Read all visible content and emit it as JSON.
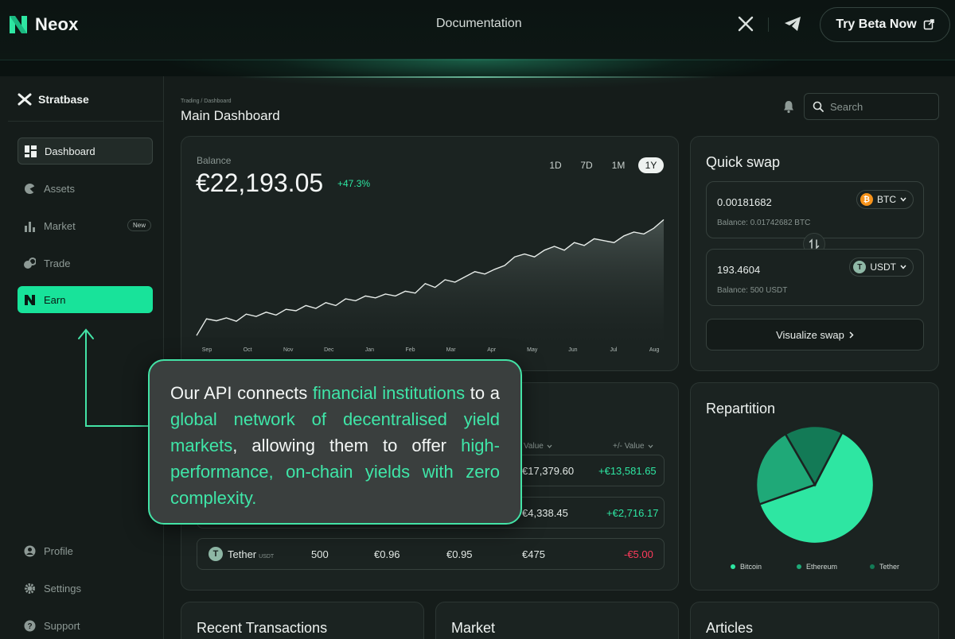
{
  "nav": {
    "brand": "Neox",
    "documentation": "Documentation",
    "cta": "Try Beta Now"
  },
  "sidebar": {
    "brand": "Stratbase",
    "items": [
      {
        "label": "Dashboard",
        "icon": "grid-icon"
      },
      {
        "label": "Assets",
        "icon": "pie-icon"
      },
      {
        "label": "Market",
        "icon": "bar-chart-icon",
        "badge": "New"
      },
      {
        "label": "Trade",
        "icon": "trade-icon"
      },
      {
        "label": "Earn",
        "icon": "neox-icon"
      }
    ],
    "bottom": [
      {
        "label": "Profile",
        "icon": "user-icon"
      },
      {
        "label": "Settings",
        "icon": "gear-icon"
      },
      {
        "label": "Support",
        "icon": "help-icon"
      }
    ]
  },
  "header": {
    "breadcrumb": "Trading / Dashboard",
    "title": "Main Dashboard",
    "search_placeholder": "Search"
  },
  "balance": {
    "label": "Balance",
    "value": "€22,193.05",
    "change": "+47.3%",
    "ranges": [
      "1D",
      "7D",
      "1M",
      "1Y"
    ],
    "selected_range": "1Y"
  },
  "chart_data": {
    "type": "area",
    "categories": [
      "Sep",
      "Oct",
      "Nov",
      "Dec",
      "Jan",
      "Feb",
      "Mar",
      "Apr",
      "May",
      "Jun",
      "Jul",
      "Aug"
    ],
    "values": [
      3,
      38,
      34,
      40,
      33,
      48,
      43,
      52,
      46,
      58,
      55,
      66,
      60,
      72,
      66,
      80,
      76,
      86,
      82,
      90,
      86,
      96,
      92,
      112,
      104,
      120,
      115,
      126,
      137,
      132,
      142,
      150,
      168,
      174,
      168,
      182,
      190,
      182,
      198,
      192,
      206,
      202,
      198,
      212,
      220,
      216,
      228,
      246
    ],
    "color": "#e7ece9",
    "grid": false
  },
  "quick_swap": {
    "title": "Quick swap",
    "from": {
      "amount": "0.00181682",
      "coin": "BTC",
      "balance": "Balance: 0.01742682 BTC"
    },
    "to": {
      "amount": "193.4604",
      "coin": "USDT",
      "balance": "Balance: 500 USDT"
    },
    "button": "Visualize swap"
  },
  "assets_table": {
    "headers": [
      "Value",
      "+/- Value"
    ],
    "rows": [
      {
        "value": "€17,379.60",
        "change": "+€13,581.65"
      },
      {
        "value": "€4,338.45",
        "change": "+€2,716.17"
      },
      {
        "name": "Tether",
        "symbol": "USDT",
        "amount": "500",
        "price": "€0.96",
        "avg": "€0.95",
        "value": "€475",
        "change": "-€5.00"
      }
    ]
  },
  "repartition": {
    "title": "Repartition",
    "legend": [
      "Bitcoin",
      "Ethereum",
      "Tether"
    ],
    "colors": [
      "#2ee6a2",
      "#1fa978",
      "#137a56"
    ],
    "shares": [
      0.62,
      0.22,
      0.16
    ]
  },
  "bottom_cards": [
    "Recent Transactions",
    "Market",
    "Articles"
  ],
  "callout": {
    "parts": [
      {
        "text": "Our API connects ",
        "hl": false
      },
      {
        "text": "financial institutions",
        "hl": true
      },
      {
        "text": " to a ",
        "hl": false
      },
      {
        "text": "global network of decentralised yield markets",
        "hl": true
      },
      {
        "text": ", allowing them to offer ",
        "hl": false
      },
      {
        "text": "high-performance, on-chain yields with zero complexity.",
        "hl": true
      }
    ]
  },
  "colors": {
    "accent": "#18e39a",
    "positive": "#2ee6a2",
    "negative": "#ff3b5c",
    "btc": "#f7931a",
    "usdt": "#8fb8a6"
  }
}
